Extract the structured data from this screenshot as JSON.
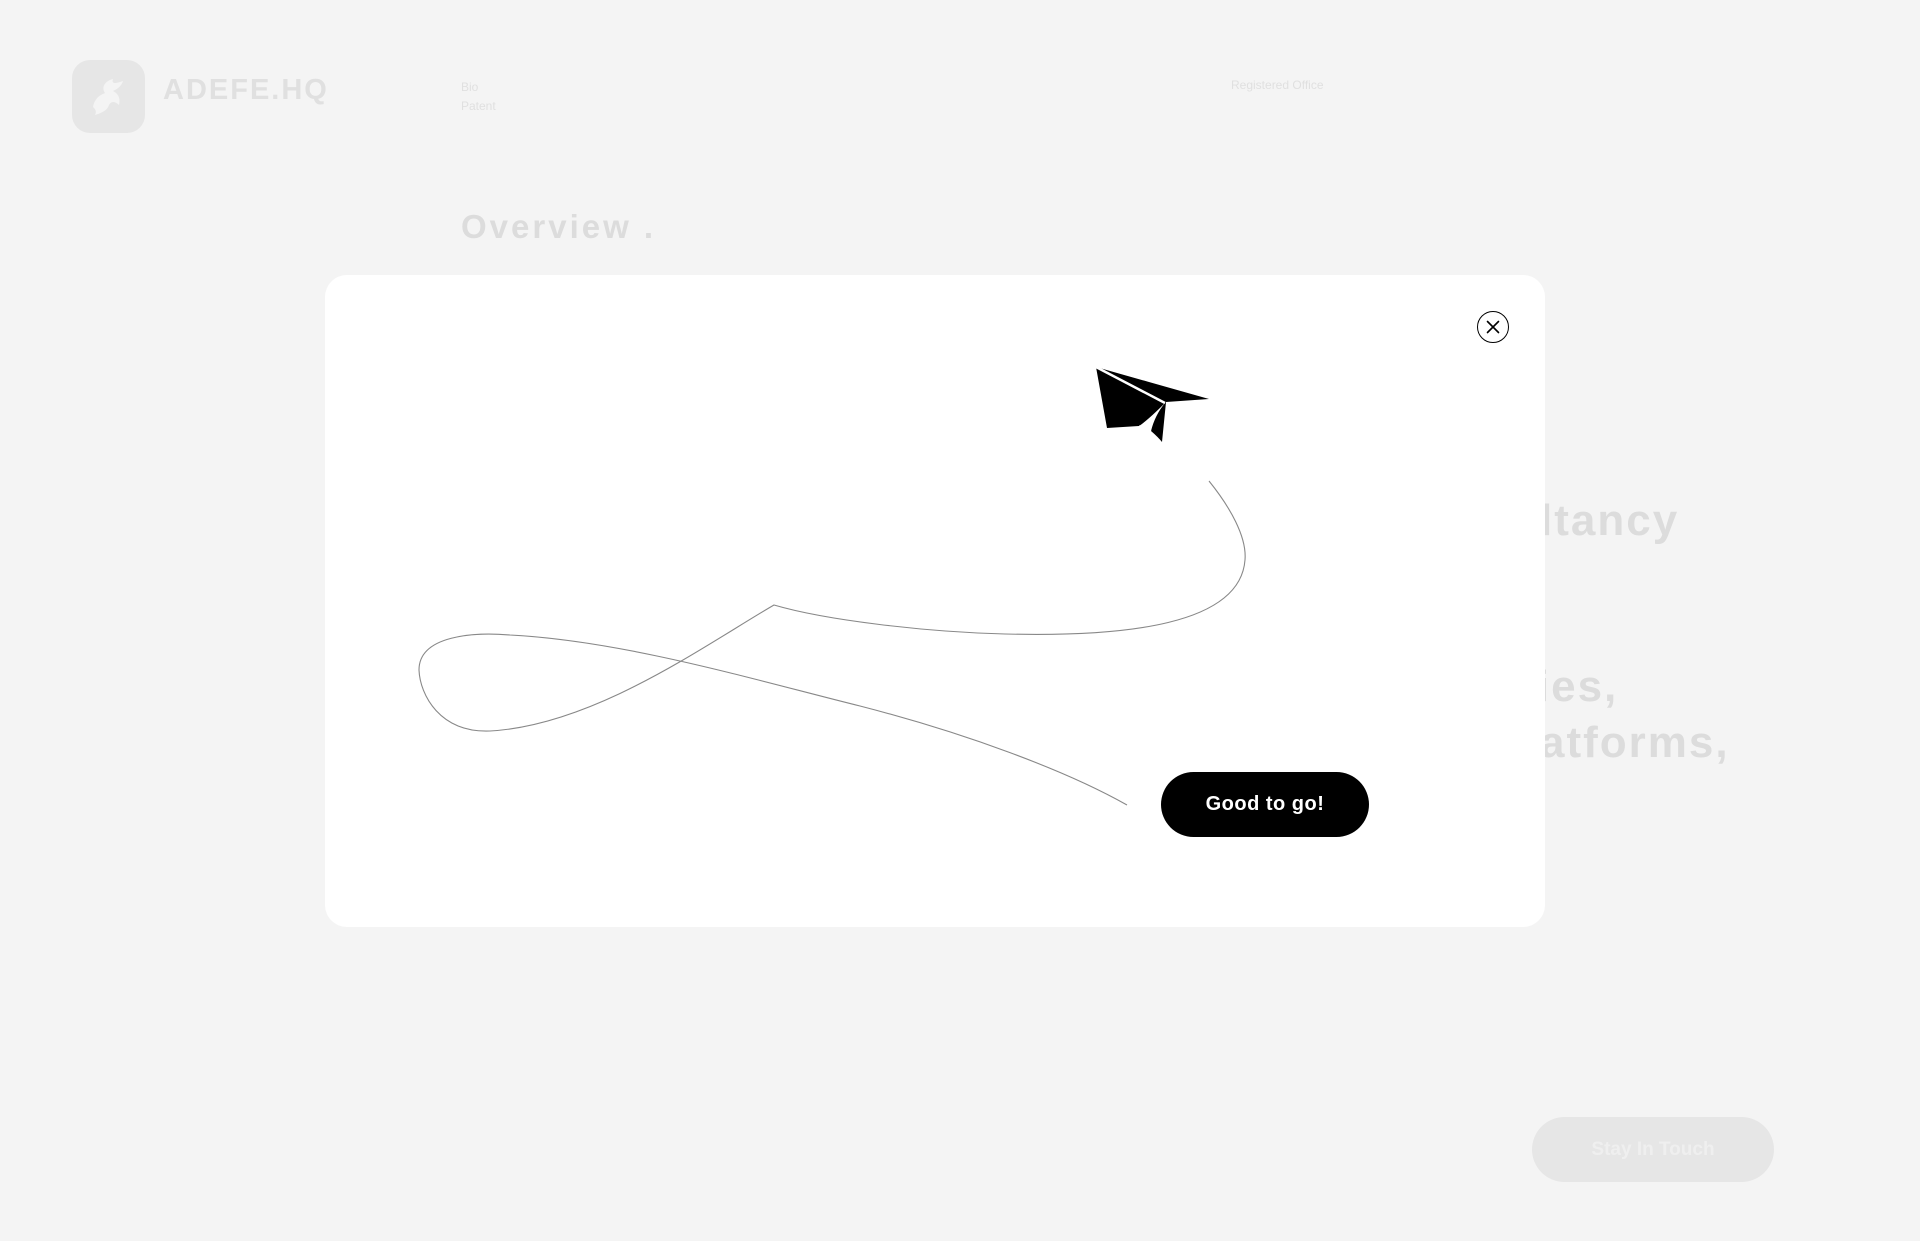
{
  "background": {
    "brand": {
      "name": "ADEFE.HQ",
      "logo_icon": "winged-horse-icon"
    },
    "nav": {
      "items": [
        "Bio",
        "Patent"
      ]
    },
    "office_link": "Registered Office",
    "section_title": "Overview .",
    "headline_fragments": [
      "ltancy",
      "nies,",
      "atforms,"
    ],
    "cta_label": "Stay In Touch"
  },
  "modal": {
    "close_icon": "close-icon",
    "illustration_icon": "paper-plane-icon",
    "confirm_label": "Good to go!",
    "colors": {
      "button_bg": "#000000",
      "button_text": "#ffffff",
      "modal_bg": "#ffffff",
      "overlay_bg": "#f4f4f4"
    }
  }
}
